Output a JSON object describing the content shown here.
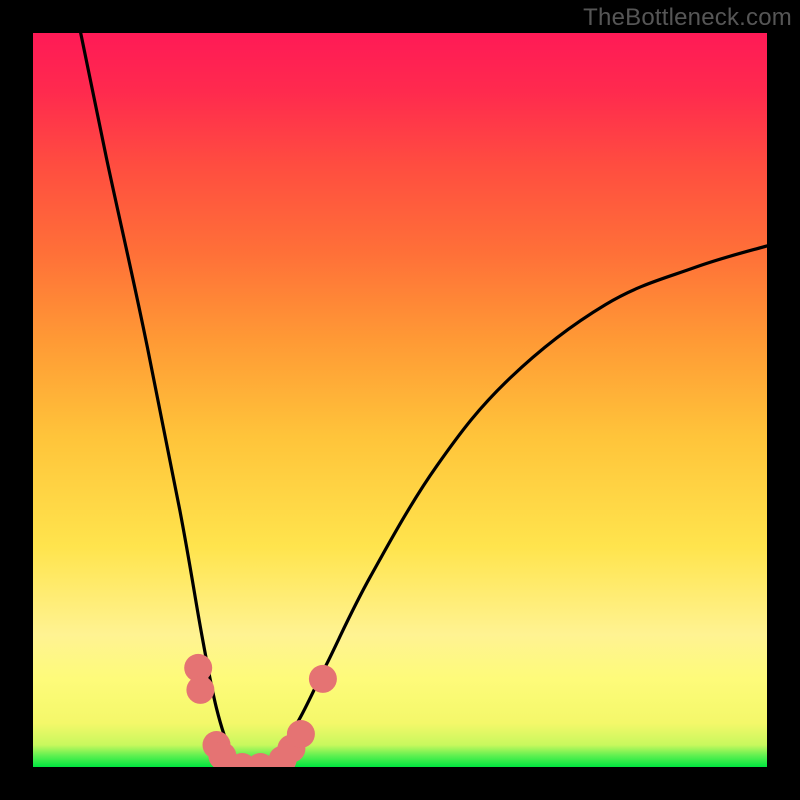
{
  "watermark": "TheBottleneck.com",
  "chart_data": {
    "type": "line",
    "title": "",
    "xlabel": "",
    "ylabel": "",
    "xlim": [
      0,
      1
    ],
    "ylim": [
      0,
      1
    ],
    "background_gradient": {
      "stops": [
        {
          "pos": 0.0,
          "color": "#00e63f"
        },
        {
          "pos": 0.03,
          "color": "#c8f85e"
        },
        {
          "pos": 0.12,
          "color": "#fefb7a"
        },
        {
          "pos": 0.3,
          "color": "#ffe44d"
        },
        {
          "pos": 0.58,
          "color": "#ff9a35"
        },
        {
          "pos": 0.82,
          "color": "#ff4d40"
        },
        {
          "pos": 1.0,
          "color": "#ff1a56"
        }
      ]
    },
    "series": [
      {
        "name": "bottleneck-curve",
        "color": "#000000",
        "x": [
          0.065,
          0.1,
          0.15,
          0.2,
          0.23,
          0.25,
          0.27,
          0.29,
          0.31,
          0.33,
          0.36,
          0.4,
          0.46,
          0.55,
          0.65,
          0.78,
          0.9,
          1.0
        ],
        "y": [
          1.0,
          0.83,
          0.6,
          0.35,
          0.18,
          0.08,
          0.02,
          0.0,
          0.0,
          0.02,
          0.06,
          0.14,
          0.26,
          0.41,
          0.53,
          0.63,
          0.68,
          0.71
        ]
      }
    ],
    "markers": [
      {
        "name": "dot-left-upper",
        "x": 0.225,
        "y": 0.135,
        "color": "#e57373",
        "r": 14
      },
      {
        "name": "dot-left-upper2",
        "x": 0.228,
        "y": 0.105,
        "color": "#e57373",
        "r": 14
      },
      {
        "name": "dot-left-low1",
        "x": 0.25,
        "y": 0.03,
        "color": "#e57373",
        "r": 14
      },
      {
        "name": "dot-left-low2",
        "x": 0.258,
        "y": 0.015,
        "color": "#e57373",
        "r": 14
      },
      {
        "name": "dot-valley1",
        "x": 0.285,
        "y": 0.0,
        "color": "#e57373",
        "r": 14
      },
      {
        "name": "dot-valley2",
        "x": 0.31,
        "y": 0.0,
        "color": "#e57373",
        "r": 14
      },
      {
        "name": "dot-right-low1",
        "x": 0.34,
        "y": 0.01,
        "color": "#e57373",
        "r": 14
      },
      {
        "name": "dot-right-low2",
        "x": 0.352,
        "y": 0.025,
        "color": "#e57373",
        "r": 14
      },
      {
        "name": "dot-right-low3",
        "x": 0.365,
        "y": 0.045,
        "color": "#e57373",
        "r": 14
      },
      {
        "name": "dot-right-upper",
        "x": 0.395,
        "y": 0.12,
        "color": "#e57373",
        "r": 14
      }
    ]
  }
}
